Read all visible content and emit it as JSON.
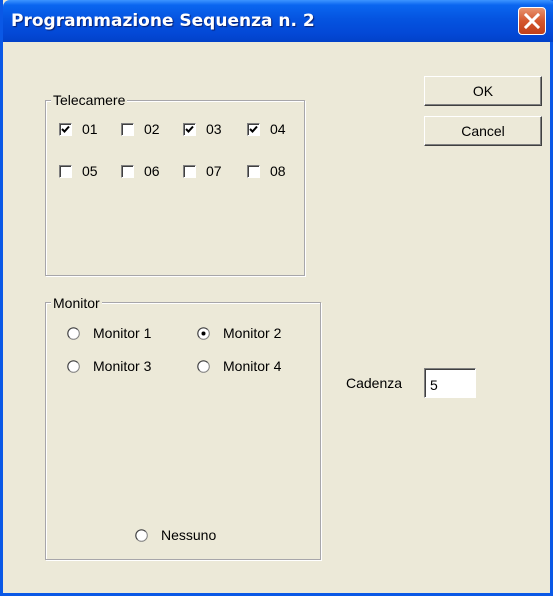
{
  "window": {
    "title": "Programmazione Sequenza n. 2"
  },
  "telecamere": {
    "label": "Telecamere",
    "items": [
      {
        "label": "01",
        "checked": true
      },
      {
        "label": "02",
        "checked": false
      },
      {
        "label": "03",
        "checked": true
      },
      {
        "label": "04",
        "checked": true
      },
      {
        "label": "05",
        "checked": false
      },
      {
        "label": "06",
        "checked": false
      },
      {
        "label": "07",
        "checked": false
      },
      {
        "label": "08",
        "checked": false
      }
    ]
  },
  "monitor": {
    "label": "Monitor",
    "options": [
      {
        "label": "Monitor 1",
        "selected": false
      },
      {
        "label": "Monitor 2",
        "selected": true
      },
      {
        "label": "Monitor 3",
        "selected": false
      },
      {
        "label": "Monitor 4",
        "selected": false
      },
      {
        "label": "Nessuno",
        "selected": false
      }
    ]
  },
  "buttons": {
    "ok": "OK",
    "cancel": "Cancel"
  },
  "cadenza": {
    "label": "Cadenza",
    "value": "5"
  },
  "colors": {
    "titlebar": "#0554e0",
    "background": "#ece9d8",
    "close_button": "#d4572e"
  },
  "icons": {
    "close": "close-icon",
    "check": "checkmark-icon"
  }
}
